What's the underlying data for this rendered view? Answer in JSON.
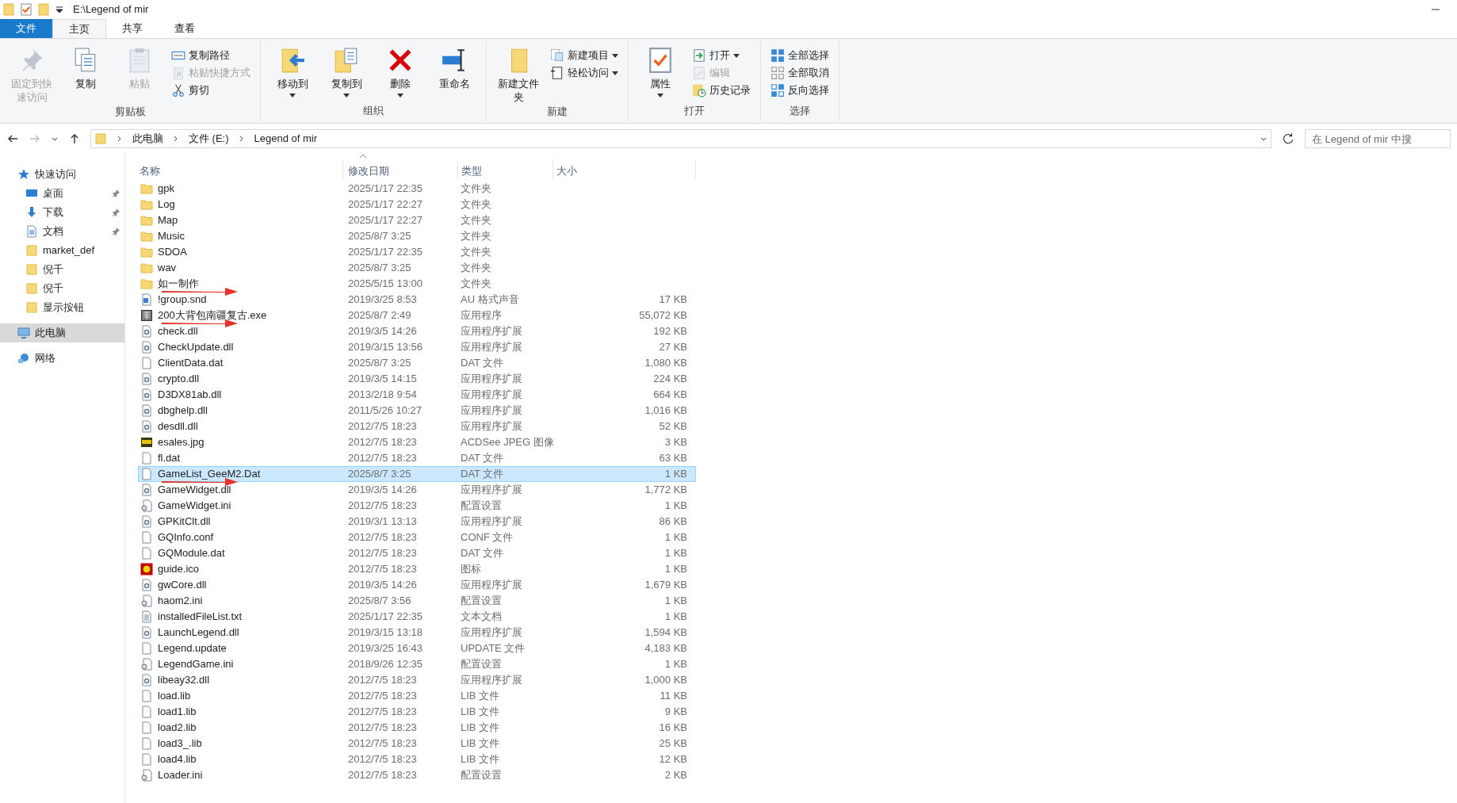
{
  "window": {
    "title": "E:\\Legend of mir"
  },
  "ribbon_tabs": [
    {
      "label": "文件",
      "kind": "file",
      "selected": false
    },
    {
      "label": "主页",
      "kind": "tab",
      "selected": true
    },
    {
      "label": "共享",
      "kind": "tab",
      "selected": false
    },
    {
      "label": "查看",
      "kind": "tab",
      "selected": false
    }
  ],
  "ribbon_groups": [
    {
      "label": "剪贴板",
      "commands": [
        {
          "label": "固定到快速访问",
          "kind": "large",
          "disabled": true,
          "dropdown": false
        },
        {
          "label": "复制",
          "kind": "large",
          "disabled": false,
          "dropdown": false
        },
        {
          "label": "粘贴",
          "kind": "large",
          "disabled": true,
          "dropdown": false
        },
        {
          "label": "复制路径",
          "kind": "small",
          "disabled": false,
          "dropdown": false
        },
        {
          "label": "粘贴快捷方式",
          "kind": "small",
          "disabled": true,
          "dropdown": false
        },
        {
          "label": "剪切",
          "kind": "small",
          "disabled": false,
          "dropdown": false
        }
      ]
    },
    {
      "label": "组织",
      "commands": [
        {
          "label": "移动到",
          "kind": "large",
          "disabled": false,
          "dropdown": true
        },
        {
          "label": "复制到",
          "kind": "large",
          "disabled": false,
          "dropdown": true
        },
        {
          "label": "删除",
          "kind": "large",
          "disabled": false,
          "dropdown": true
        },
        {
          "label": "重命名",
          "kind": "large",
          "disabled": false,
          "dropdown": false
        }
      ]
    },
    {
      "label": "新建",
      "commands": [
        {
          "label": "新建文件夹",
          "kind": "large",
          "disabled": false,
          "dropdown": false
        },
        {
          "label": "新建项目",
          "kind": "small",
          "disabled": false,
          "dropdown": true
        },
        {
          "label": "轻松访问",
          "kind": "small",
          "disabled": false,
          "dropdown": true
        }
      ]
    },
    {
      "label": "打开",
      "commands": [
        {
          "label": "属性",
          "kind": "large",
          "disabled": false,
          "dropdown": true
        },
        {
          "label": "打开",
          "kind": "small",
          "disabled": false,
          "dropdown": true
        },
        {
          "label": "编辑",
          "kind": "small",
          "disabled": true,
          "dropdown": false
        },
        {
          "label": "历史记录",
          "kind": "small",
          "disabled": false,
          "dropdown": false
        }
      ]
    },
    {
      "label": "选择",
      "commands": [
        {
          "label": "全部选择",
          "kind": "small",
          "disabled": false,
          "dropdown": false
        },
        {
          "label": "全部取消",
          "kind": "small",
          "disabled": false,
          "dropdown": false
        },
        {
          "label": "反向选择",
          "kind": "small",
          "disabled": false,
          "dropdown": false
        }
      ]
    }
  ],
  "address_bar": {
    "breadcrumbs": [
      "此电脑",
      "文件 (E:)",
      "Legend of mir"
    ]
  },
  "search": {
    "placeholder": "在 Legend of mir 中搜"
  },
  "sidebar": {
    "items": [
      {
        "label": "快速访问",
        "kind": "star",
        "selected": false,
        "children": [
          {
            "label": "桌面",
            "kind": "desktop",
            "pinned": true,
            "selected": false
          },
          {
            "label": "下载",
            "kind": "download",
            "pinned": true,
            "selected": false
          },
          {
            "label": "文档",
            "kind": "doc",
            "pinned": true,
            "selected": false
          },
          {
            "label": "market_def",
            "kind": "folder",
            "pinned": false,
            "selected": false
          },
          {
            "label": "倪千",
            "kind": "folder",
            "pinned": false,
            "selected": false
          },
          {
            "label": "倪千",
            "kind": "folder",
            "pinned": false,
            "selected": false
          },
          {
            "label": "显示按钮",
            "kind": "folder",
            "pinned": false,
            "selected": false
          }
        ]
      },
      {
        "label": "此电脑",
        "kind": "pc",
        "selected": true
      },
      {
        "label": "网络",
        "kind": "network",
        "selected": false
      }
    ]
  },
  "table": {
    "columns": [
      "名称",
      "修改日期",
      "类型",
      "大小"
    ],
    "rows": [
      {
        "name": "gpk",
        "date": "2025/1/17 22:35",
        "type": "文件夹",
        "kind": "folder",
        "selected": false,
        "marked": false
      },
      {
        "name": "Log",
        "date": "2025/1/17 22:27",
        "type": "文件夹",
        "kind": "folder",
        "selected": false,
        "marked": false
      },
      {
        "name": "Map",
        "date": "2025/1/17 22:27",
        "type": "文件夹",
        "kind": "folder",
        "selected": false,
        "marked": false
      },
      {
        "name": "Music",
        "date": "2025/8/7 3:25",
        "type": "文件夹",
        "kind": "folder",
        "selected": false,
        "marked": false
      },
      {
        "name": "SDOA",
        "date": "2025/1/17 22:35",
        "type": "文件夹",
        "kind": "folder",
        "selected": false,
        "marked": false
      },
      {
        "name": "wav",
        "date": "2025/8/7 3:25",
        "type": "文件夹",
        "kind": "folder",
        "selected": false,
        "marked": false
      },
      {
        "name": "如一制作",
        "date": "2025/5/15 13:00",
        "type": "文件夹",
        "kind": "folder",
        "selected": false,
        "marked": true
      },
      {
        "name": "!group.snd",
        "date": "2019/3/25 8:53",
        "type": "AU 格式声音",
        "size": "17 KB",
        "kind": "audio",
        "selected": false,
        "marked": false
      },
      {
        "name": "200大背包南疆复古.exe",
        "date": "2025/8/7 2:49",
        "type": "应用程序",
        "size": "55,072 KB",
        "kind": "exe",
        "selected": false,
        "marked": true
      },
      {
        "name": "check.dll",
        "date": "2019/3/5 14:26",
        "type": "应用程序扩展",
        "size": "192 KB",
        "kind": "dll",
        "selected": false,
        "marked": false
      },
      {
        "name": "CheckUpdate.dll",
        "date": "2019/3/15 13:56",
        "type": "应用程序扩展",
        "size": "27 KB",
        "kind": "dll",
        "selected": false,
        "marked": false
      },
      {
        "name": "ClientData.dat",
        "date": "2025/8/7 3:25",
        "type": "DAT 文件",
        "size": "1,080 KB",
        "kind": "blank",
        "selected": false,
        "marked": false
      },
      {
        "name": "crypto.dll",
        "date": "2019/3/5 14:15",
        "type": "应用程序扩展",
        "size": "224 KB",
        "kind": "dll",
        "selected": false,
        "marked": false
      },
      {
        "name": "D3DX81ab.dll",
        "date": "2013/2/18 9:54",
        "type": "应用程序扩展",
        "size": "664 KB",
        "kind": "dll",
        "selected": false,
        "marked": false
      },
      {
        "name": "dbghelp.dll",
        "date": "2011/5/26 10:27",
        "type": "应用程序扩展",
        "size": "1,016 KB",
        "kind": "dll",
        "selected": false,
        "marked": false
      },
      {
        "name": "desdll.dll",
        "date": "2012/7/5 18:23",
        "type": "应用程序扩展",
        "size": "52 KB",
        "kind": "dll",
        "selected": false,
        "marked": false
      },
      {
        "name": "esales.jpg",
        "date": "2012/7/5 18:23",
        "type": "ACDSee JPEG 图像",
        "size": "3 KB",
        "kind": "jpg",
        "selected": false,
        "marked": false
      },
      {
        "name": "fl.dat",
        "date": "2012/7/5 18:23",
        "type": "DAT 文件",
        "size": "63 KB",
        "kind": "blank",
        "selected": false,
        "marked": false
      },
      {
        "name": "GameList_GeeM2.Dat",
        "date": "2025/8/7 3:25",
        "type": "DAT 文件",
        "size": "1 KB",
        "kind": "blank",
        "selected": true,
        "marked": true
      },
      {
        "name": "GameWidget.dll",
        "date": "2019/3/5 14:26",
        "type": "应用程序扩展",
        "size": "1,772 KB",
        "kind": "dll",
        "selected": false,
        "marked": false
      },
      {
        "name": "GameWidget.ini",
        "date": "2012/7/5 18:23",
        "type": "配置设置",
        "size": "1 KB",
        "kind": "ini",
        "selected": false,
        "marked": false
      },
      {
        "name": "GPKitClt.dll",
        "date": "2019/3/1 13:13",
        "type": "应用程序扩展",
        "size": "86 KB",
        "kind": "dll",
        "selected": false,
        "marked": false
      },
      {
        "name": "GQInfo.conf",
        "date": "2012/7/5 18:23",
        "type": "CONF 文件",
        "size": "1 KB",
        "kind": "blank",
        "selected": false,
        "marked": false
      },
      {
        "name": "GQModule.dat",
        "date": "2012/7/5 18:23",
        "type": "DAT 文件",
        "size": "1 KB",
        "kind": "blank",
        "selected": false,
        "marked": false
      },
      {
        "name": "guide.ico",
        "date": "2012/7/5 18:23",
        "type": "图标",
        "size": "1 KB",
        "kind": "ico",
        "selected": false,
        "marked": false
      },
      {
        "name": "gwCore.dll",
        "date": "2019/3/5 14:26",
        "type": "应用程序扩展",
        "size": "1,679 KB",
        "kind": "dll",
        "selected": false,
        "marked": false
      },
      {
        "name": "haom2.ini",
        "date": "2025/8/7 3:56",
        "type": "配置设置",
        "size": "1 KB",
        "kind": "ini",
        "selected": false,
        "marked": false
      },
      {
        "name": "installedFileList.txt",
        "date": "2025/1/17 22:35",
        "type": "文本文档",
        "size": "1 KB",
        "kind": "txt",
        "selected": false,
        "marked": false
      },
      {
        "name": "LaunchLegend.dll",
        "date": "2019/3/15 13:18",
        "type": "应用程序扩展",
        "size": "1,594 KB",
        "kind": "dll",
        "selected": false,
        "marked": false
      },
      {
        "name": "Legend.update",
        "date": "2019/3/25 16:43",
        "type": "UPDATE 文件",
        "size": "4,183 KB",
        "kind": "blank",
        "selected": false,
        "marked": false
      },
      {
        "name": "LegendGame.ini",
        "date": "2018/9/26 12:35",
        "type": "配置设置",
        "size": "1 KB",
        "kind": "ini",
        "selected": false,
        "marked": false
      },
      {
        "name": "libeay32.dll",
        "date": "2012/7/5 18:23",
        "type": "应用程序扩展",
        "size": "1,000 KB",
        "kind": "dll",
        "selected": false,
        "marked": false
      },
      {
        "name": "load.lib",
        "date": "2012/7/5 18:23",
        "type": "LIB 文件",
        "size": "11 KB",
        "kind": "blank",
        "selected": false,
        "marked": false
      },
      {
        "name": "load1.lib",
        "date": "2012/7/5 18:23",
        "type": "LIB 文件",
        "size": "9 KB",
        "kind": "blank",
        "selected": false,
        "marked": false
      },
      {
        "name": "load2.lib",
        "date": "2012/7/5 18:23",
        "type": "LIB 文件",
        "size": "16 KB",
        "kind": "blank",
        "selected": false,
        "marked": false
      },
      {
        "name": "load3_.lib",
        "date": "2012/7/5 18:23",
        "type": "LIB 文件",
        "size": "25 KB",
        "kind": "blank",
        "selected": false,
        "marked": false
      },
      {
        "name": "load4.lib",
        "date": "2012/7/5 18:23",
        "type": "LIB 文件",
        "size": "12 KB",
        "kind": "blank",
        "selected": false,
        "marked": false
      },
      {
        "name": "Loader.ini",
        "date": "2012/7/5 18:23",
        "type": "配置设置",
        "size": "2 KB",
        "kind": "ini",
        "selected": false,
        "marked": false
      }
    ]
  }
}
